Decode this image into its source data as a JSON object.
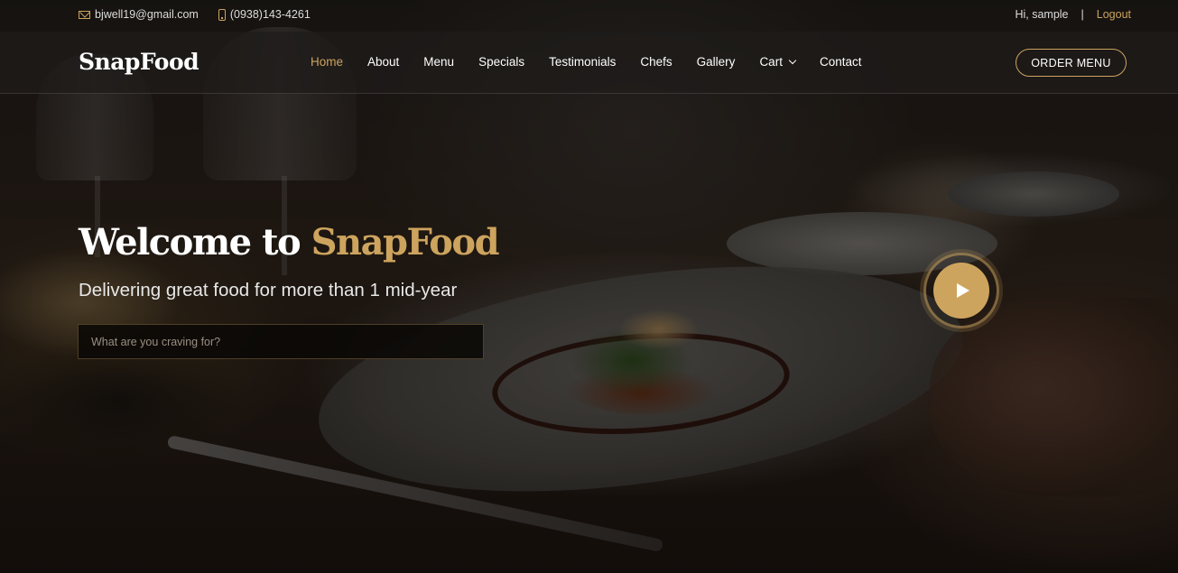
{
  "topbar": {
    "email": "bjwell19@gmail.com",
    "phone": "(0938)143-4261",
    "greeting": "Hi, sample",
    "separator": "|",
    "logout_label": "Logout",
    "email_icon": "envelope-icon",
    "phone_icon": "mobile-phone-icon"
  },
  "header": {
    "logo": "SnapFood",
    "nav": [
      {
        "label": "Home",
        "active": true
      },
      {
        "label": "About"
      },
      {
        "label": "Menu"
      },
      {
        "label": "Specials"
      },
      {
        "label": "Testimonials"
      },
      {
        "label": "Chefs"
      },
      {
        "label": "Gallery"
      },
      {
        "label": "Cart",
        "dropdown": true
      },
      {
        "label": "Contact"
      }
    ],
    "cart_icon": "chevron-down-icon",
    "order_button": "ORDER MENU"
  },
  "hero": {
    "title_prefix": "Welcome to",
    "title_brand": "SnapFood",
    "subtitle": "Delivering great food for more than 1 mid-year",
    "search_placeholder": "What are you craving for?",
    "search_value": "",
    "play_icon": "play-icon"
  },
  "colors": {
    "accent": "#cda45e",
    "text": "#ffffff",
    "header_bg": "#1e1c1a"
  }
}
